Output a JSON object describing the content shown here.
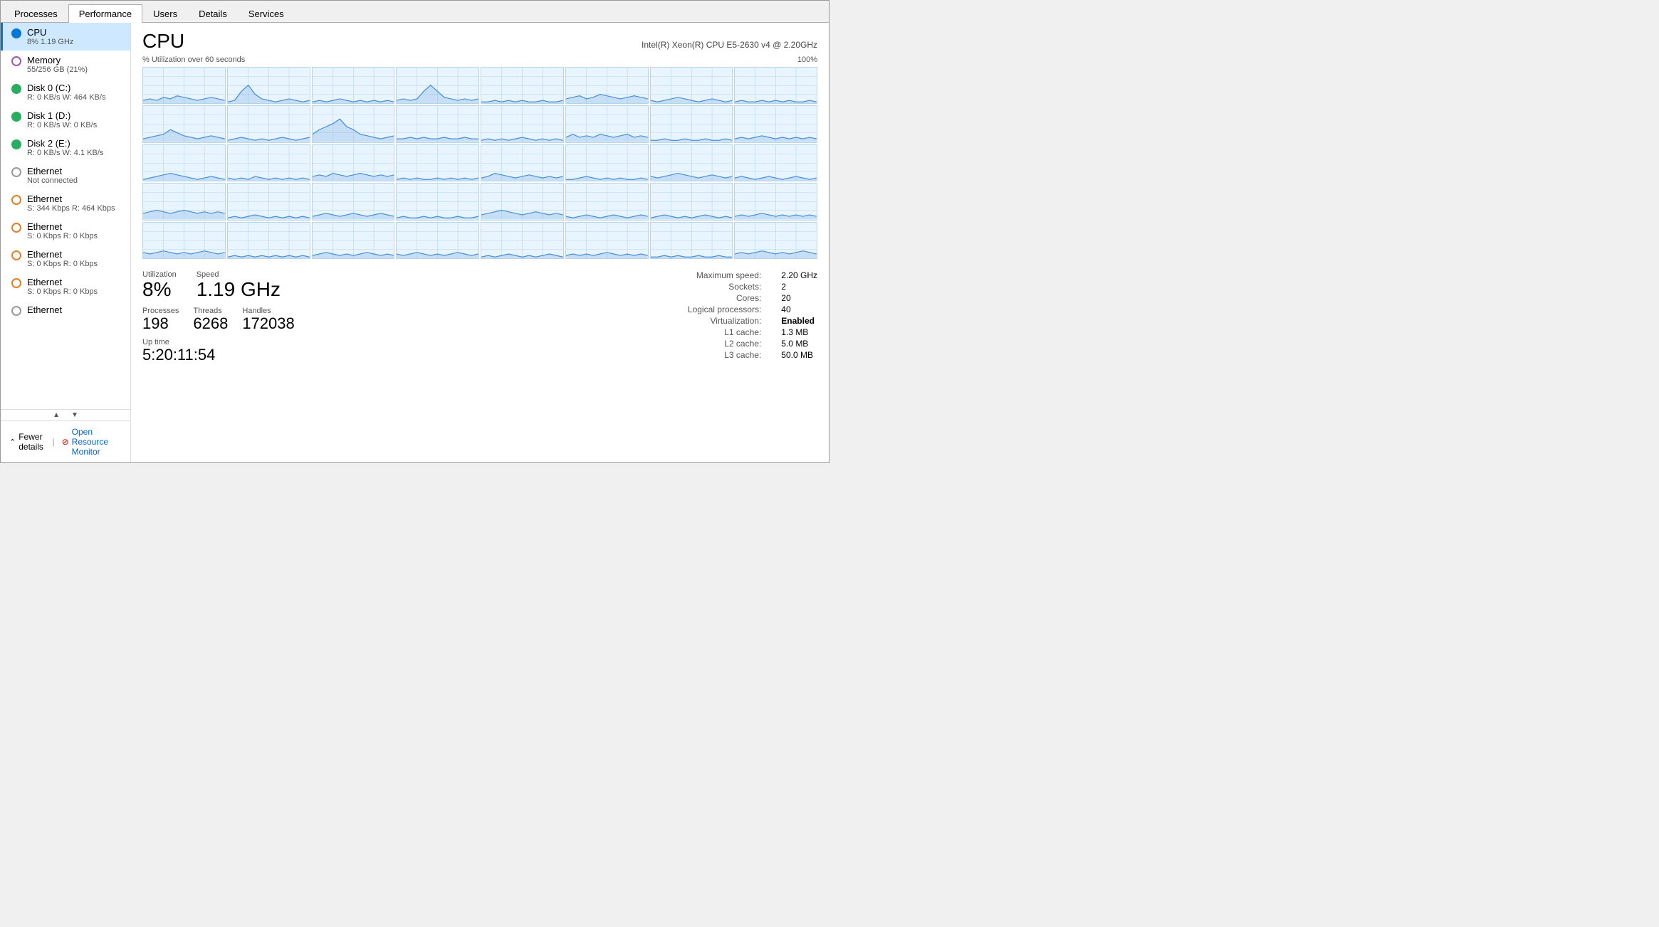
{
  "tabs": [
    {
      "id": "processes",
      "label": "Processes",
      "active": false
    },
    {
      "id": "performance",
      "label": "Performance",
      "active": true
    },
    {
      "id": "users",
      "label": "Users",
      "active": false
    },
    {
      "id": "details",
      "label": "Details",
      "active": false
    },
    {
      "id": "services",
      "label": "Services",
      "active": false
    }
  ],
  "sidebar": {
    "items": [
      {
        "id": "cpu",
        "name": "CPU",
        "sub": "8%  1.19 GHz",
        "icon": "blue-filled",
        "active": true
      },
      {
        "id": "memory",
        "name": "Memory",
        "sub": "55/256 GB (21%)",
        "icon": "purple",
        "active": false
      },
      {
        "id": "disk0",
        "name": "Disk 0 (C:)",
        "sub": "R: 0 KB/s  W: 464 KB/s",
        "icon": "green",
        "active": false
      },
      {
        "id": "disk1",
        "name": "Disk 1 (D:)",
        "sub": "R: 0 KB/s  W: 0 KB/s",
        "icon": "green",
        "active": false
      },
      {
        "id": "disk2",
        "name": "Disk 2 (E:)",
        "sub": "R: 0 KB/s  W: 4.1 KB/s",
        "icon": "green",
        "active": false
      },
      {
        "id": "ethernet0",
        "name": "Ethernet",
        "sub": "Not connected",
        "icon": "gray",
        "active": false
      },
      {
        "id": "ethernet1",
        "name": "Ethernet",
        "sub": "S: 344 Kbps  R: 464 Kbps",
        "icon": "orange",
        "active": false
      },
      {
        "id": "ethernet2",
        "name": "Ethernet",
        "sub": "S: 0 Kbps  R: 0 Kbps",
        "icon": "orange",
        "active": false
      },
      {
        "id": "ethernet3",
        "name": "Ethernet",
        "sub": "S: 0 Kbps  R: 0 Kbps",
        "icon": "orange",
        "active": false
      },
      {
        "id": "ethernet4",
        "name": "Ethernet",
        "sub": "S: 0 Kbps  R: 0 Kbps",
        "icon": "orange",
        "active": false
      },
      {
        "id": "ethernet5",
        "name": "Ethernet",
        "sub": "...",
        "icon": "gray",
        "active": false
      }
    ],
    "fewer_details": "Fewer details",
    "open_resource_monitor": "Open Resource Monitor"
  },
  "cpu": {
    "title": "CPU",
    "model": "Intel(R) Xeon(R) CPU E5-2630 v4 @ 2.20GHz",
    "chart_label": "% Utilization over 60 seconds",
    "chart_max": "100%",
    "utilization_label": "Utilization",
    "utilization_value": "8%",
    "speed_label": "Speed",
    "speed_value": "1.19 GHz",
    "processes_label": "Processes",
    "processes_value": "198",
    "threads_label": "Threads",
    "threads_value": "6268",
    "handles_label": "Handles",
    "handles_value": "172038",
    "uptime_label": "Up time",
    "uptime_value": "5:20:11:54",
    "details": [
      {
        "label": "Maximum speed:",
        "value": "2.20 GHz",
        "bold": false
      },
      {
        "label": "Sockets:",
        "value": "2",
        "bold": false
      },
      {
        "label": "Cores:",
        "value": "20",
        "bold": false
      },
      {
        "label": "Logical processors:",
        "value": "40",
        "bold": false
      },
      {
        "label": "Virtualization:",
        "value": "Enabled",
        "bold": true
      },
      {
        "label": "L1 cache:",
        "value": "1.3 MB",
        "bold": false
      },
      {
        "label": "L2 cache:",
        "value": "5.0 MB",
        "bold": false
      },
      {
        "label": "L3 cache:",
        "value": "50.0 MB",
        "bold": false
      }
    ]
  }
}
